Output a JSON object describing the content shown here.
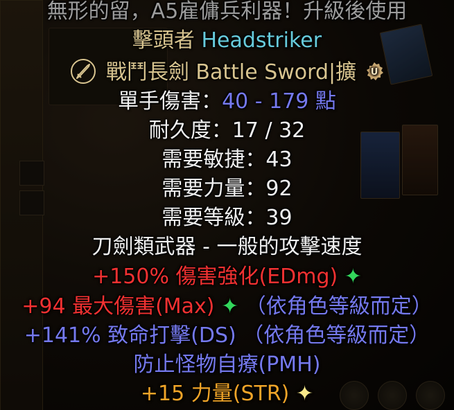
{
  "tooltip": {
    "requirement_note": "無形的留，A5雇傭兵利器！升級後使用",
    "unique_name_cn": "擊頭者",
    "unique_name_en": "Headstriker",
    "base_item": "戰鬥長劍 Battle Sword",
    "base_suffix": "|擴",
    "damage_label": "單手傷害：",
    "damage_value": "40 - 179 點",
    "durability": "耐久度：17 / 32",
    "req_dex": "需要敏捷：43",
    "req_str": "需要力量：92",
    "req_level": "需要等級：39",
    "weapon_class": "刀劍類武器 - 一般的攻擊速度",
    "mods": [
      {
        "text": "+150% 傷害強化(EDmg)",
        "star": "✦"
      },
      {
        "text": "+94 最大傷害(Max)",
        "star": "✦",
        "note": "（依角色等級而定）"
      },
      {
        "text": "+141% 致命打擊(DS)",
        "note": "（依角色等級而定）"
      },
      {
        "text": "防止怪物自療(PMH)"
      },
      {
        "text": "+15 力量(STR)",
        "star": "✦"
      }
    ]
  },
  "icons": {
    "sword": "sword-icon",
    "unique": "unique-badge-icon",
    "star": "sparkle-star-icon"
  },
  "colors": {
    "white": "#f0f0f0",
    "grey": "#9c9c9c",
    "gold": "#d8c48f",
    "cyan": "#67cbdc",
    "blue": "#7579ee",
    "red": "#f23131",
    "orange": "#f0a428"
  }
}
